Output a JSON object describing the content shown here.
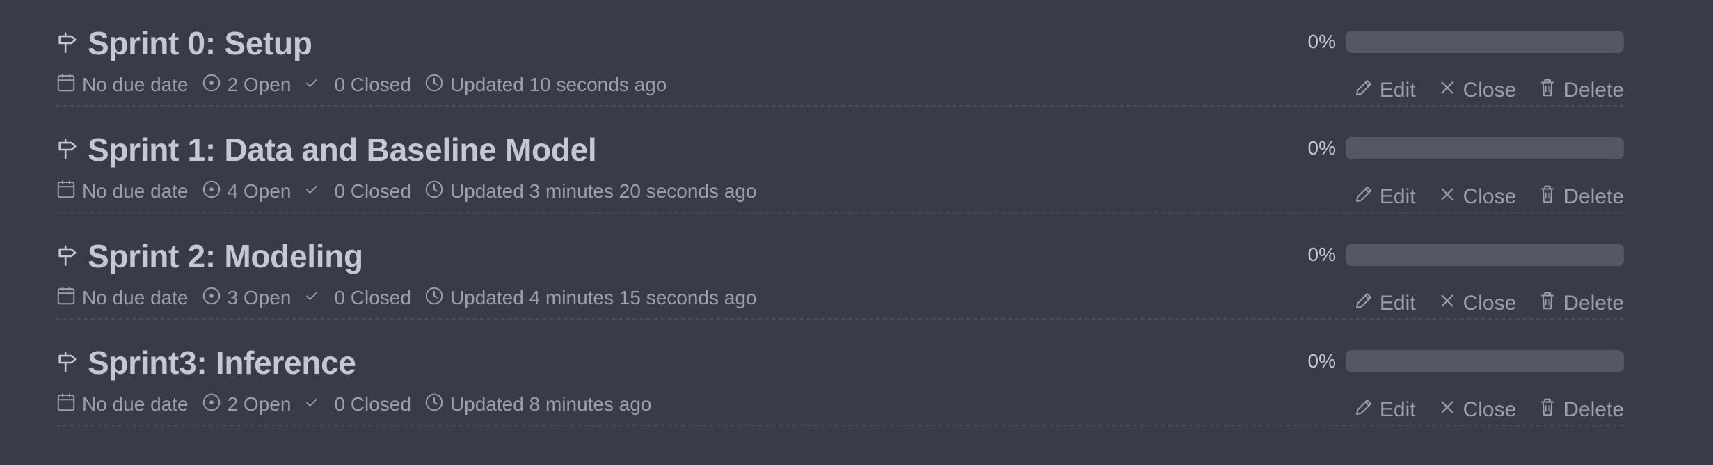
{
  "colors": {
    "background": "#393c48",
    "title": "#c4c8d6",
    "meta": "#9a9fb0",
    "progress_track": "#535766",
    "divider": "#4a4e5c"
  },
  "icons": {
    "title": "milestone-signpost-icon",
    "due": "calendar-icon",
    "open": "issue-open-icon",
    "closed": "check-icon",
    "updated": "clock-icon",
    "edit": "pencil-icon",
    "close": "x-icon",
    "delete": "trash-icon"
  },
  "milestones": [
    {
      "title": "Sprint 0: Setup",
      "due": "No due date",
      "open": "2 Open",
      "closed": "0 Closed",
      "updated": "Updated 10 seconds ago",
      "progress_label": "0%",
      "progress_fraction": 0,
      "actions": {
        "edit": "Edit",
        "close": "Close",
        "delete": "Delete"
      }
    },
    {
      "title": "Sprint 1: Data and Baseline Model",
      "due": "No due date",
      "open": "4 Open",
      "closed": "0 Closed",
      "updated": "Updated 3 minutes 20 seconds ago",
      "progress_label": "0%",
      "progress_fraction": 0,
      "actions": {
        "edit": "Edit",
        "close": "Close",
        "delete": "Delete"
      }
    },
    {
      "title": "Sprint 2: Modeling",
      "due": "No due date",
      "open": "3 Open",
      "closed": "0 Closed",
      "updated": "Updated 4 minutes 15 seconds ago",
      "progress_label": "0%",
      "progress_fraction": 0,
      "actions": {
        "edit": "Edit",
        "close": "Close",
        "delete": "Delete"
      }
    },
    {
      "title": "Sprint3: Inference",
      "due": "No due date",
      "open": "2 Open",
      "closed": "0 Closed",
      "updated": "Updated 8 minutes ago",
      "progress_label": "0%",
      "progress_fraction": 0,
      "actions": {
        "edit": "Edit",
        "close": "Close",
        "delete": "Delete"
      }
    }
  ]
}
